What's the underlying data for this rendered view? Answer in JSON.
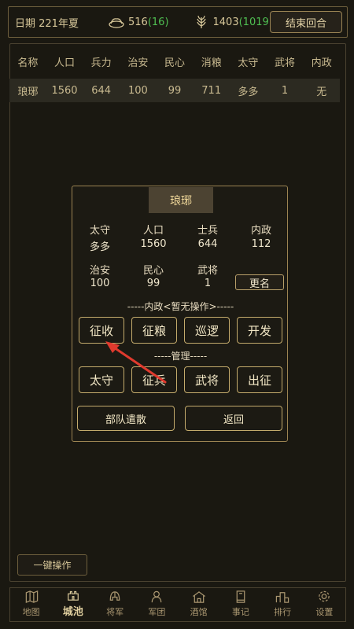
{
  "topbar": {
    "date": "日期 221年夏",
    "silver_value": "516",
    "silver_gain": "(16)",
    "grain_value": "1403",
    "grain_gain": "(1019)",
    "end_turn": "结束回合"
  },
  "city_table": {
    "headers": [
      "名称",
      "人口",
      "兵力",
      "治安",
      "民心",
      "消粮",
      "太守",
      "武将",
      "内政"
    ],
    "rows": [
      [
        "琅琊",
        "1560",
        "644",
        "100",
        "99",
        "711",
        "多多",
        "1",
        "无"
      ]
    ]
  },
  "dialog": {
    "title": "琅琊",
    "governor_label": "太守",
    "governor_value": "多多",
    "population_label": "人口",
    "population_value": "1560",
    "soldiers_label": "士兵",
    "soldiers_value": "644",
    "internal_label": "内政",
    "internal_value": "112",
    "security_label": "治安",
    "security_value": "100",
    "morale_label": "民心",
    "morale_value": "99",
    "generals_label": "武将",
    "generals_value": "1",
    "rename": "更名",
    "internal_section": "-----内政<暂无操作>-----",
    "internal_buttons": [
      "征收",
      "征粮",
      "巡逻",
      "开发"
    ],
    "manage_section": "-----管理-----",
    "manage_buttons": [
      "太守",
      "征兵",
      "武将",
      "出征"
    ],
    "disband": "部队遣散",
    "back": "返回"
  },
  "one_click": "一键操作",
  "nav": {
    "items": [
      "地图",
      "城池",
      "将军",
      "军团",
      "酒馆",
      "事记",
      "排行",
      "设置"
    ],
    "icons": [
      "map-icon",
      "castle-icon",
      "helmet-icon",
      "army-icon",
      "tavern-icon",
      "book-icon",
      "ranking-icon",
      "gear-icon"
    ],
    "active": "城池"
  },
  "colors": {
    "background": "#1a1811",
    "gold_border": "#c4ab6c",
    "text": "#d8c89a",
    "gain_green": "#4fbf52",
    "arrow_red": "#e03a2e"
  }
}
